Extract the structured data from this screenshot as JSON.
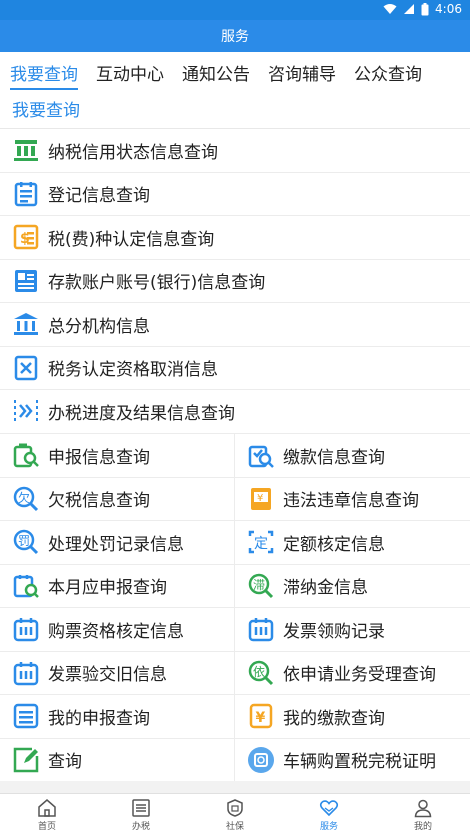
{
  "status": {
    "time": "4:06"
  },
  "appbar": {
    "title": "服务"
  },
  "tabs": [
    {
      "label": "我要查询"
    },
    {
      "label": "互动中心"
    },
    {
      "label": "通知公告"
    },
    {
      "label": "咨询辅导"
    },
    {
      "label": "公众查询"
    }
  ],
  "section": {
    "title": "我要查询"
  },
  "list": [
    {
      "label": "纳税信用状态信息查询",
      "icon": "building-icon"
    },
    {
      "label": "登记信息查询",
      "icon": "calendar-list-icon"
    },
    {
      "label": "税(费)种认定信息查询",
      "icon": "tax-document-icon"
    },
    {
      "label": "存款账户账号(银行)信息查询",
      "icon": "bank-account-icon"
    },
    {
      "label": "总分机构信息",
      "icon": "institution-icon"
    },
    {
      "label": "税务认定资格取消信息",
      "icon": "cancel-document-icon"
    },
    {
      "label": "办税进度及结果信息查询",
      "icon": "progress-icon"
    }
  ],
  "grid": [
    [
      {
        "label": "申报信息查询",
        "icon": "declare-search-icon"
      },
      {
        "label": "缴款信息查询",
        "icon": "payment-search-icon"
      }
    ],
    [
      {
        "label": "欠税信息查询",
        "icon": "owed-tax-search-icon"
      },
      {
        "label": "违法违章信息查询",
        "icon": "violation-icon"
      }
    ],
    [
      {
        "label": "处理处罚记录信息",
        "icon": "penalty-search-icon"
      },
      {
        "label": "定额核定信息",
        "icon": "quota-icon"
      }
    ],
    [
      {
        "label": "本月应申报查询",
        "icon": "monthly-declare-icon"
      },
      {
        "label": "滞纳金信息",
        "icon": "late-fee-icon"
      }
    ],
    [
      {
        "label": "购票资格核定信息",
        "icon": "ticket-qualification-icon"
      },
      {
        "label": "发票领购记录",
        "icon": "invoice-record-icon"
      }
    ],
    [
      {
        "label": "发票验交旧信息",
        "icon": "invoice-verify-icon"
      },
      {
        "label": "依申请业务受理查询",
        "icon": "application-search-icon"
      }
    ],
    [
      {
        "label": "我的申报查询",
        "icon": "my-declare-icon"
      },
      {
        "label": "我的缴款查询",
        "icon": "my-payment-icon"
      }
    ],
    [
      {
        "label": "查询",
        "icon": "edit-search-icon"
      },
      {
        "label": "车辆购置税完税证明",
        "icon": "vehicle-tax-icon"
      }
    ]
  ],
  "iconText": {
    "progress": "》",
    "owed": "欠",
    "penalty": "罚",
    "quota": "定",
    "late": "滞",
    "apply": "依",
    "yen": "¥"
  },
  "nav": [
    {
      "label": "首页",
      "icon": "home-icon"
    },
    {
      "label": "办税",
      "icon": "tax-handling-icon"
    },
    {
      "label": "社保",
      "icon": "social-security-icon"
    },
    {
      "label": "服务",
      "icon": "service-heart-icon"
    },
    {
      "label": "我的",
      "icon": "profile-icon"
    }
  ],
  "colors": {
    "brand": "#2b8be8",
    "green": "#33a852",
    "orange": "#f5a623",
    "blue": "#2b8be8"
  }
}
